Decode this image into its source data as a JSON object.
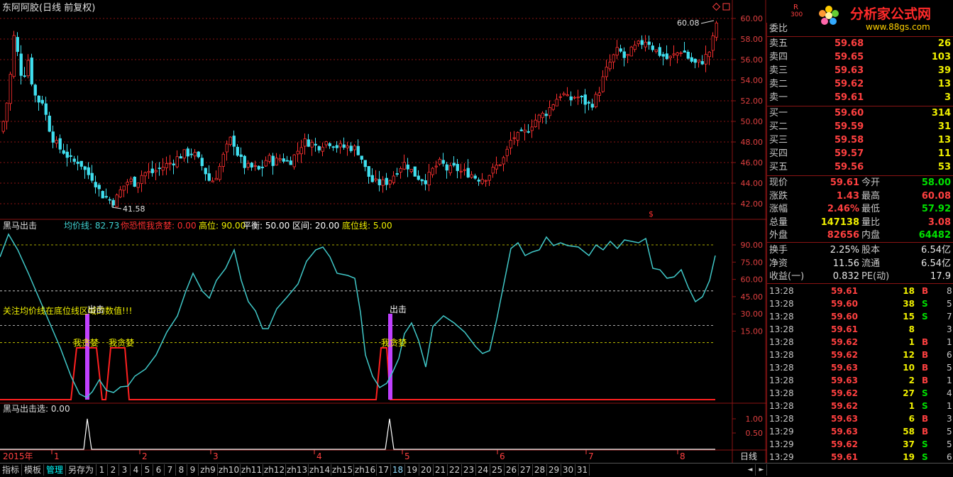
{
  "header": {
    "title": "东阿阿胶(日线 前复权)",
    "badge_r": "R",
    "badge_300": "300",
    "logo_text": "分析家公式网",
    "logo_url": "www.88gs.com"
  },
  "price_axis": [
    "60.00",
    "58.00",
    "56.00",
    "54.00",
    "52.00",
    "50.00",
    "48.00",
    "46.00",
    "44.00",
    "42.00"
  ],
  "price_annotations": {
    "high": "60.08",
    "low": "41.58"
  },
  "indicator_header": {
    "name": "黑马出击",
    "items": [
      {
        "label": "均价线: 82.73",
        "color": "#40d0d0"
      },
      {
        "label": "你恐慌我贪婪: 0.00",
        "color": "#ff3030"
      },
      {
        "label": "高位: 90.00",
        "color": "#f0f000"
      },
      {
        "label": "平衡: 50.00",
        "color": "#ffffff"
      },
      {
        "label": "区间: 20.00",
        "color": "#ffffff"
      },
      {
        "label": "底位线: 5.00",
        "color": "#f0f000"
      }
    ]
  },
  "indicator_axis": [
    "90.00",
    "75.00",
    "60.00",
    "45.00",
    "30.00",
    "15.00"
  ],
  "indicator_notes": {
    "focus": "关注均价线在底位线区域的数值!!!",
    "buy": "出击",
    "greed": "我贪婪"
  },
  "lower_header": "黑马出击选: 0.00",
  "lower_axis": [
    "1.00",
    "0.50"
  ],
  "date_axis": {
    "year": "2015年",
    "months": [
      "1",
      "2",
      "3",
      "4",
      "5",
      "6",
      "7",
      "8"
    ],
    "period": "日线"
  },
  "quote": {
    "weibi": "委比",
    "asks": [
      {
        "label": "卖五",
        "price": "59.68",
        "vol": "26"
      },
      {
        "label": "卖四",
        "price": "59.65",
        "vol": "103"
      },
      {
        "label": "卖三",
        "price": "59.63",
        "vol": "39"
      },
      {
        "label": "卖二",
        "price": "59.62",
        "vol": "13"
      },
      {
        "label": "卖一",
        "price": "59.61",
        "vol": "3"
      }
    ],
    "bids": [
      {
        "label": "买一",
        "price": "59.60",
        "vol": "314"
      },
      {
        "label": "买二",
        "price": "59.59",
        "vol": "31"
      },
      {
        "label": "买三",
        "price": "59.58",
        "vol": "13"
      },
      {
        "label": "买四",
        "price": "59.57",
        "vol": "11"
      },
      {
        "label": "买五",
        "price": "59.56",
        "vol": "53"
      }
    ],
    "stats": [
      {
        "l1": "现价",
        "v1": "59.61",
        "c1": "red",
        "l2": "今开",
        "v2": "58.00",
        "c2": "green"
      },
      {
        "l1": "涨跌",
        "v1": "1.43",
        "c1": "red",
        "l2": "最高",
        "v2": "60.08",
        "c2": "red"
      },
      {
        "l1": "涨幅",
        "v1": "2.46%",
        "c1": "red",
        "l2": "最低",
        "v2": "57.92",
        "c2": "green"
      },
      {
        "l1": "总量",
        "v1": "147138",
        "c1": "yellow",
        "l2": "量比",
        "v2": "3.08",
        "c2": "red"
      },
      {
        "l1": "外盘",
        "v1": "82656",
        "c1": "red",
        "l2": "内盘",
        "v2": "64482",
        "c2": "green"
      }
    ],
    "stats2": [
      {
        "l1": "换手",
        "v1": "2.25%",
        "l2": "股本",
        "v2": "6.54亿"
      },
      {
        "l1": "净资",
        "v1": "11.56",
        "l2": "流通",
        "v2": "6.54亿"
      },
      {
        "l1": "收益(一)",
        "v1": "0.832",
        "l2": "PE(动)",
        "v2": "17.9"
      }
    ]
  },
  "ticks": [
    {
      "time": "13:28",
      "price": "59.61",
      "vol": "18",
      "side": "B",
      "n": "8"
    },
    {
      "time": "13:28",
      "price": "59.60",
      "vol": "38",
      "side": "S",
      "n": "5"
    },
    {
      "time": "13:28",
      "price": "59.60",
      "vol": "15",
      "side": "S",
      "n": "7"
    },
    {
      "time": "13:28",
      "price": "59.61",
      "vol": "8",
      "side": "",
      "n": "3"
    },
    {
      "time": "13:28",
      "price": "59.62",
      "vol": "1",
      "side": "B",
      "n": "1"
    },
    {
      "time": "13:28",
      "price": "59.62",
      "vol": "12",
      "side": "B",
      "n": "6"
    },
    {
      "time": "13:28",
      "price": "59.63",
      "vol": "10",
      "side": "B",
      "n": "5"
    },
    {
      "time": "13:28",
      "price": "59.63",
      "vol": "2",
      "side": "B",
      "n": "1"
    },
    {
      "time": "13:28",
      "price": "59.62",
      "vol": "27",
      "side": "S",
      "n": "4"
    },
    {
      "time": "13:28",
      "price": "59.62",
      "vol": "1",
      "side": "S",
      "n": "1"
    },
    {
      "time": "13:28",
      "price": "59.63",
      "vol": "6",
      "side": "B",
      "n": "3"
    },
    {
      "time": "13:29",
      "price": "59.63",
      "vol": "58",
      "side": "B",
      "n": "5"
    },
    {
      "time": "13:29",
      "price": "59.62",
      "vol": "37",
      "side": "S",
      "n": "5"
    },
    {
      "time": "13:29",
      "price": "59.61",
      "vol": "19",
      "side": "S",
      "n": "6"
    }
  ],
  "bottom_tabs": [
    "指标",
    "模板",
    "管理",
    "另存为",
    "1",
    "2",
    "3",
    "4",
    "5",
    "6",
    "7",
    "8",
    "9",
    "zh9",
    "zh10",
    "zh11",
    "zh12",
    "zh13",
    "zh14",
    "zh15",
    "zh16",
    "17",
    "18",
    "19",
    "20",
    "21",
    "22",
    "23",
    "24",
    "25",
    "26",
    "27",
    "28",
    "29",
    "30",
    "31"
  ],
  "colors": {
    "up": "#ff3030",
    "down": "#40e0f0",
    "grid": "#8a1414",
    "avg_line": "#40c8c8",
    "signal": "#ff2020",
    "bar": "#c040ff"
  }
}
